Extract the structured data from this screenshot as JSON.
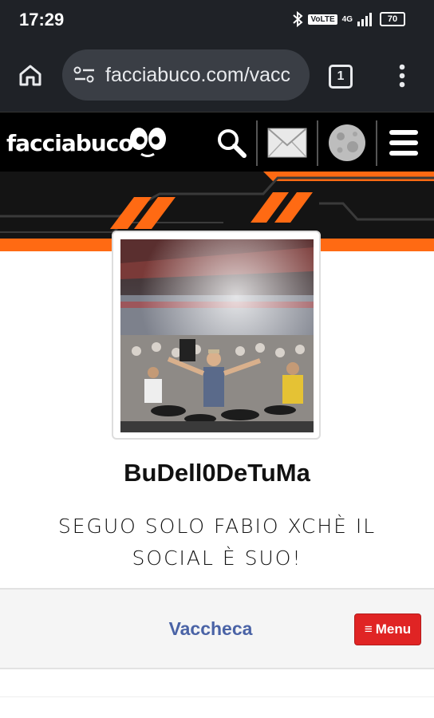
{
  "status": {
    "time": "17:29",
    "volte": "VoLTE",
    "network": "4G",
    "battery": "70"
  },
  "browser": {
    "url": "facciabuco.com/vacc",
    "tab_count": "1"
  },
  "site": {
    "logo": "facciabuco"
  },
  "profile": {
    "username": "BuDell0DeTuMa",
    "bio_line1": "SEGUO SOLO FABIO XCHÈ IL",
    "bio_line2": "SOCIAL È SUO!"
  },
  "nav": {
    "title": "Vaccheca",
    "menu_label": "Menu",
    "menu_icon": "≡"
  },
  "colors": {
    "accent": "#ff6a13",
    "menu_red": "#e02424",
    "link_blue": "#4a63a6",
    "header_black": "#000000"
  }
}
